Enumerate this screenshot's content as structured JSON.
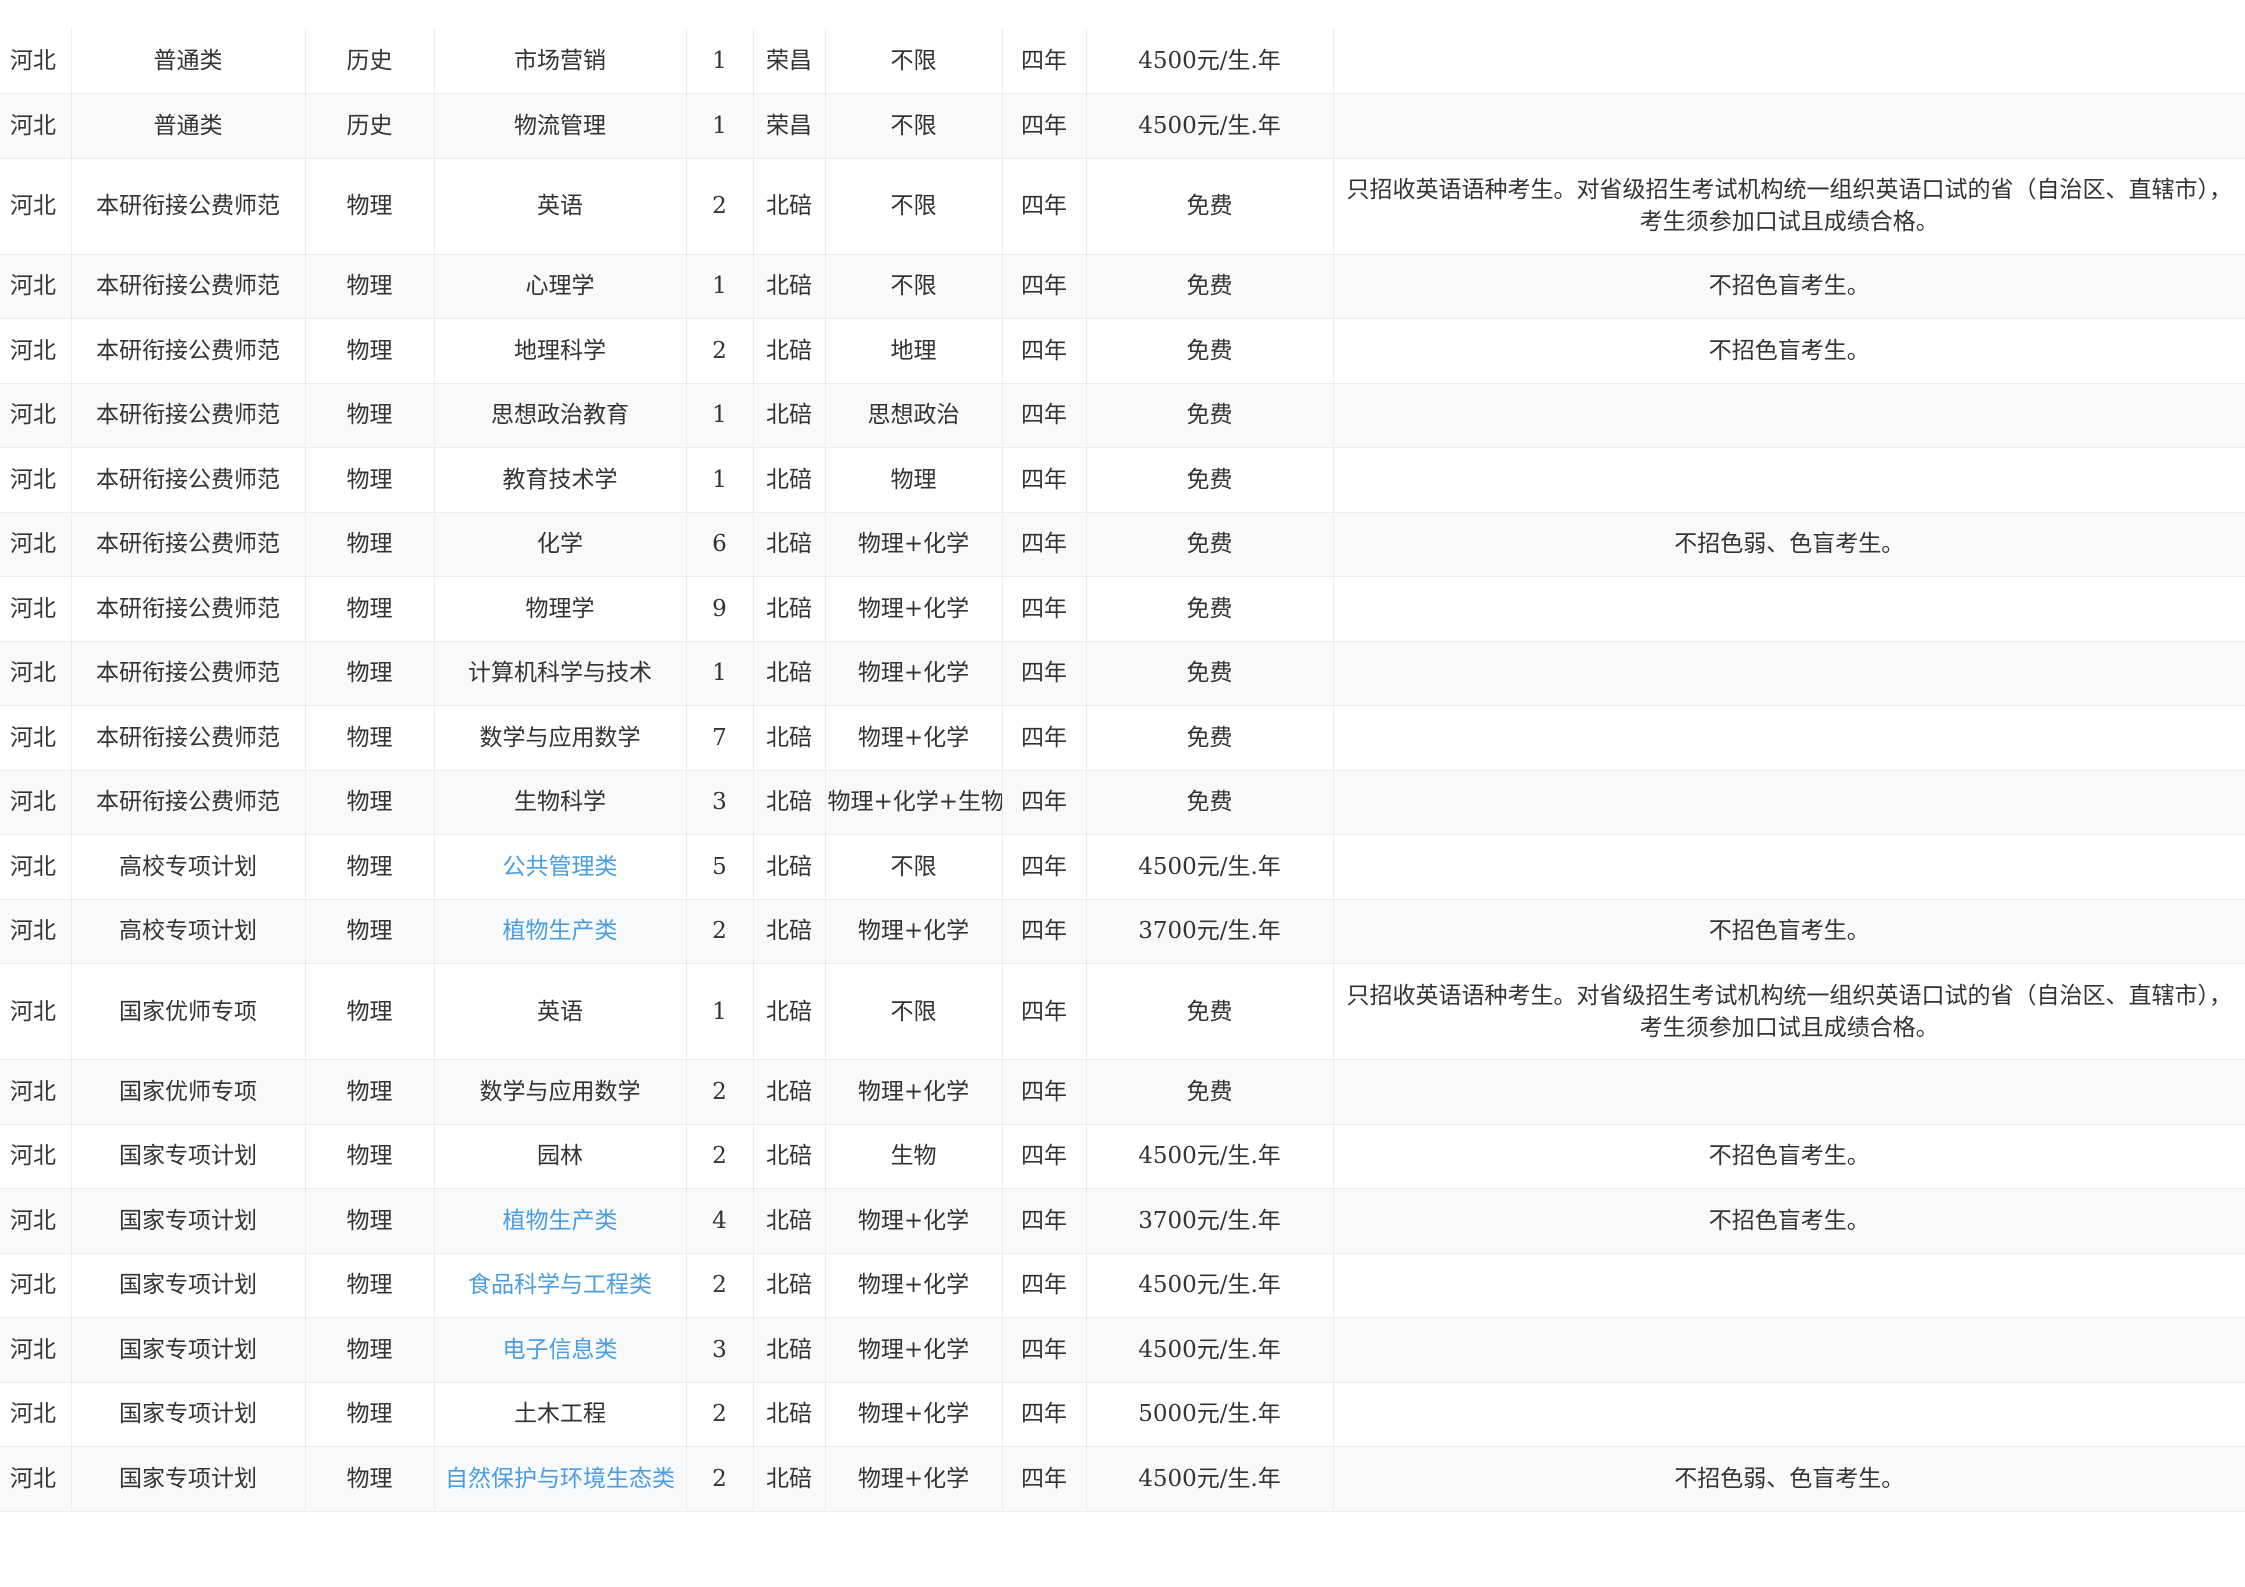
{
  "rows": [
    {
      "province": "河北",
      "batch": "普通类",
      "subject": "历史",
      "major": "市场营销",
      "major_link": false,
      "count": "1",
      "campus": "荣昌",
      "requirement": "不限",
      "duration": "四年",
      "tuition": "4500元/生.年",
      "note": ""
    },
    {
      "province": "河北",
      "batch": "普通类",
      "subject": "历史",
      "major": "物流管理",
      "major_link": false,
      "count": "1",
      "campus": "荣昌",
      "requirement": "不限",
      "duration": "四年",
      "tuition": "4500元/生.年",
      "note": ""
    },
    {
      "province": "河北",
      "batch": "本研衔接公费师范",
      "subject": "物理",
      "major": "英语",
      "major_link": false,
      "count": "2",
      "campus": "北碚",
      "requirement": "不限",
      "duration": "四年",
      "tuition": "免费",
      "note": "只招收英语语种考生。对省级招生考试机构统一组织英语口试的省（自治区、直辖市），考生须参加口试且成绩合格。"
    },
    {
      "province": "河北",
      "batch": "本研衔接公费师范",
      "subject": "物理",
      "major": "心理学",
      "major_link": false,
      "count": "1",
      "campus": "北碚",
      "requirement": "不限",
      "duration": "四年",
      "tuition": "免费",
      "note": "不招色盲考生。"
    },
    {
      "province": "河北",
      "batch": "本研衔接公费师范",
      "subject": "物理",
      "major": "地理科学",
      "major_link": false,
      "count": "2",
      "campus": "北碚",
      "requirement": "地理",
      "duration": "四年",
      "tuition": "免费",
      "note": "不招色盲考生。"
    },
    {
      "province": "河北",
      "batch": "本研衔接公费师范",
      "subject": "物理",
      "major": "思想政治教育",
      "major_link": false,
      "count": "1",
      "campus": "北碚",
      "requirement": "思想政治",
      "duration": "四年",
      "tuition": "免费",
      "note": ""
    },
    {
      "province": "河北",
      "batch": "本研衔接公费师范",
      "subject": "物理",
      "major": "教育技术学",
      "major_link": false,
      "count": "1",
      "campus": "北碚",
      "requirement": "物理",
      "duration": "四年",
      "tuition": "免费",
      "note": ""
    },
    {
      "province": "河北",
      "batch": "本研衔接公费师范",
      "subject": "物理",
      "major": "化学",
      "major_link": false,
      "count": "6",
      "campus": "北碚",
      "requirement": "物理+化学",
      "duration": "四年",
      "tuition": "免费",
      "note": "不招色弱、色盲考生。"
    },
    {
      "province": "河北",
      "batch": "本研衔接公费师范",
      "subject": "物理",
      "major": "物理学",
      "major_link": false,
      "count": "9",
      "campus": "北碚",
      "requirement": "物理+化学",
      "duration": "四年",
      "tuition": "免费",
      "note": ""
    },
    {
      "province": "河北",
      "batch": "本研衔接公费师范",
      "subject": "物理",
      "major": "计算机科学与技术",
      "major_link": false,
      "count": "1",
      "campus": "北碚",
      "requirement": "物理+化学",
      "duration": "四年",
      "tuition": "免费",
      "note": ""
    },
    {
      "province": "河北",
      "batch": "本研衔接公费师范",
      "subject": "物理",
      "major": "数学与应用数学",
      "major_link": false,
      "count": "7",
      "campus": "北碚",
      "requirement": "物理+化学",
      "duration": "四年",
      "tuition": "免费",
      "note": ""
    },
    {
      "province": "河北",
      "batch": "本研衔接公费师范",
      "subject": "物理",
      "major": "生物科学",
      "major_link": false,
      "count": "3",
      "campus": "北碚",
      "requirement": "物理+化学+生物",
      "duration": "四年",
      "tuition": "免费",
      "note": ""
    },
    {
      "province": "河北",
      "batch": "高校专项计划",
      "subject": "物理",
      "major": "公共管理类",
      "major_link": true,
      "count": "5",
      "campus": "北碚",
      "requirement": "不限",
      "duration": "四年",
      "tuition": "4500元/生.年",
      "note": ""
    },
    {
      "province": "河北",
      "batch": "高校专项计划",
      "subject": "物理",
      "major": "植物生产类",
      "major_link": true,
      "count": "2",
      "campus": "北碚",
      "requirement": "物理+化学",
      "duration": "四年",
      "tuition": "3700元/生.年",
      "note": "不招色盲考生。"
    },
    {
      "province": "河北",
      "batch": "国家优师专项",
      "subject": "物理",
      "major": "英语",
      "major_link": false,
      "count": "1",
      "campus": "北碚",
      "requirement": "不限",
      "duration": "四年",
      "tuition": "免费",
      "note": "只招收英语语种考生。对省级招生考试机构统一组织英语口试的省（自治区、直辖市），考生须参加口试且成绩合格。"
    },
    {
      "province": "河北",
      "batch": "国家优师专项",
      "subject": "物理",
      "major": "数学与应用数学",
      "major_link": false,
      "count": "2",
      "campus": "北碚",
      "requirement": "物理+化学",
      "duration": "四年",
      "tuition": "免费",
      "note": ""
    },
    {
      "province": "河北",
      "batch": "国家专项计划",
      "subject": "物理",
      "major": "园林",
      "major_link": false,
      "count": "2",
      "campus": "北碚",
      "requirement": "生物",
      "duration": "四年",
      "tuition": "4500元/生.年",
      "note": "不招色盲考生。"
    },
    {
      "province": "河北",
      "batch": "国家专项计划",
      "subject": "物理",
      "major": "植物生产类",
      "major_link": true,
      "count": "4",
      "campus": "北碚",
      "requirement": "物理+化学",
      "duration": "四年",
      "tuition": "3700元/生.年",
      "note": "不招色盲考生。"
    },
    {
      "province": "河北",
      "batch": "国家专项计划",
      "subject": "物理",
      "major": "食品科学与工程类",
      "major_link": true,
      "count": "2",
      "campus": "北碚",
      "requirement": "物理+化学",
      "duration": "四年",
      "tuition": "4500元/生.年",
      "note": ""
    },
    {
      "province": "河北",
      "batch": "国家专项计划",
      "subject": "物理",
      "major": "电子信息类",
      "major_link": true,
      "count": "3",
      "campus": "北碚",
      "requirement": "物理+化学",
      "duration": "四年",
      "tuition": "4500元/生.年",
      "note": ""
    },
    {
      "province": "河北",
      "batch": "国家专项计划",
      "subject": "物理",
      "major": "土木工程",
      "major_link": false,
      "count": "2",
      "campus": "北碚",
      "requirement": "物理+化学",
      "duration": "四年",
      "tuition": "5000元/生.年",
      "note": ""
    },
    {
      "province": "河北",
      "batch": "国家专项计划",
      "subject": "物理",
      "major": "自然保护与环境生态类",
      "major_link": true,
      "count": "2",
      "campus": "北碚",
      "requirement": "物理+化学",
      "duration": "四年",
      "tuition": "4500元/生.年",
      "note": "不招色弱、色盲考生。"
    }
  ],
  "colors": {
    "link": "#4a9de3",
    "text": "#333333",
    "stripe": "#f8f9fa",
    "border": "#ececec"
  }
}
